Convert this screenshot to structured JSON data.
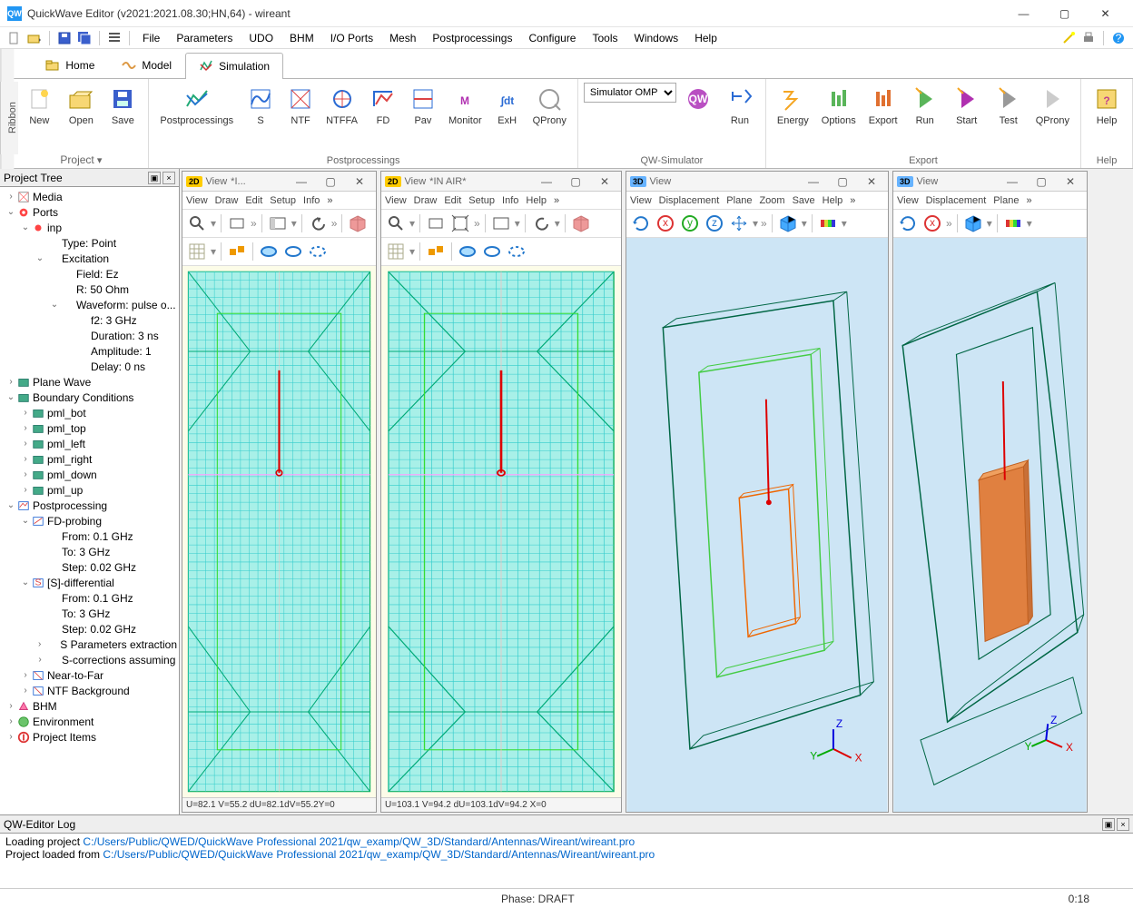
{
  "window": {
    "title": "QuickWave Editor (v2021:2021.08.30;HN,64) - wireant"
  },
  "menu": [
    "File",
    "Parameters",
    "UDO",
    "BHM",
    "I/O Ports",
    "Mesh",
    "Postprocessings",
    "Configure",
    "Tools",
    "Windows",
    "Help"
  ],
  "ribbon_tabs": [
    {
      "icon": "folder",
      "label": "Home"
    },
    {
      "icon": "wave",
      "label": "Model"
    },
    {
      "icon": "sim",
      "label": "Simulation",
      "active": true
    }
  ],
  "ribbon": {
    "project": {
      "label": "Project",
      "buttons": [
        {
          "label": "New",
          "icon": "new"
        },
        {
          "label": "Open",
          "icon": "open"
        },
        {
          "label": "Save",
          "icon": "save"
        }
      ]
    },
    "postproc": {
      "label": "Postprocessings",
      "header": "Postprocessings",
      "buttons": [
        {
          "label": "S",
          "icon": "s"
        },
        {
          "label": "NTF",
          "icon": "ntf"
        },
        {
          "label": "NTFFA",
          "icon": "ntffa"
        },
        {
          "label": "FD",
          "icon": "fd"
        },
        {
          "label": "Pav",
          "icon": "pav"
        },
        {
          "label": "Monitor",
          "icon": "mon"
        },
        {
          "label": "ExH",
          "icon": "exh"
        },
        {
          "label": "QProny",
          "icon": "qp"
        }
      ]
    },
    "simulator": {
      "label": "QW-Simulator",
      "select_value": "Simulator OMP",
      "run": "Run"
    },
    "export": {
      "label": "Export",
      "buttons": [
        {
          "label": "Energy",
          "icon": "en"
        },
        {
          "label": "Options",
          "icon": "opt"
        },
        {
          "label": "Export",
          "icon": "exp"
        },
        {
          "label": "Run",
          "icon": "run2"
        },
        {
          "label": "Start",
          "icon": "start"
        },
        {
          "label": "Test",
          "icon": "test"
        },
        {
          "label": "QProny",
          "icon": "qp2"
        }
      ]
    },
    "help": {
      "label": "Help"
    }
  },
  "project_tree": {
    "title": "Project Tree",
    "nodes": [
      {
        "d": 0,
        "tw": ">",
        "icon": "media",
        "label": "Media"
      },
      {
        "d": 0,
        "tw": "v",
        "icon": "ports",
        "label": "Ports"
      },
      {
        "d": 1,
        "tw": "v",
        "icon": "port",
        "label": "inp"
      },
      {
        "d": 2,
        "tw": "",
        "icon": "",
        "label": "Type: Point"
      },
      {
        "d": 2,
        "tw": "v",
        "icon": "",
        "label": "Excitation"
      },
      {
        "d": 3,
        "tw": "",
        "icon": "",
        "label": "Field: Ez"
      },
      {
        "d": 3,
        "tw": "",
        "icon": "",
        "label": "R: 50 Ohm"
      },
      {
        "d": 3,
        "tw": "v",
        "icon": "",
        "label": "Waveform: pulse o..."
      },
      {
        "d": 4,
        "tw": "",
        "icon": "",
        "label": "f2: 3 GHz"
      },
      {
        "d": 4,
        "tw": "",
        "icon": "",
        "label": "Duration: 3 ns"
      },
      {
        "d": 4,
        "tw": "",
        "icon": "",
        "label": "Amplitude: 1"
      },
      {
        "d": 4,
        "tw": "",
        "icon": "",
        "label": "Delay: 0 ns"
      },
      {
        "d": 0,
        "tw": ">",
        "icon": "pw",
        "label": "Plane Wave"
      },
      {
        "d": 0,
        "tw": "v",
        "icon": "bc",
        "label": "Boundary Conditions"
      },
      {
        "d": 1,
        "tw": ">",
        "icon": "pml",
        "label": "pml_bot"
      },
      {
        "d": 1,
        "tw": ">",
        "icon": "pml",
        "label": "pml_top"
      },
      {
        "d": 1,
        "tw": ">",
        "icon": "pml",
        "label": "pml_left"
      },
      {
        "d": 1,
        "tw": ">",
        "icon": "pml",
        "label": "pml_right"
      },
      {
        "d": 1,
        "tw": ">",
        "icon": "pml",
        "label": "pml_down"
      },
      {
        "d": 1,
        "tw": ">",
        "icon": "pml",
        "label": "pml_up"
      },
      {
        "d": 0,
        "tw": "v",
        "icon": "pp",
        "label": "Postprocessing"
      },
      {
        "d": 1,
        "tw": "v",
        "icon": "fd",
        "label": "FD-probing"
      },
      {
        "d": 2,
        "tw": "",
        "icon": "",
        "label": "From: 0.1 GHz"
      },
      {
        "d": 2,
        "tw": "",
        "icon": "",
        "label": "To: 3 GHz"
      },
      {
        "d": 2,
        "tw": "",
        "icon": "",
        "label": "Step: 0.02 GHz"
      },
      {
        "d": 1,
        "tw": "v",
        "icon": "sd",
        "label": "[S]-differential"
      },
      {
        "d": 2,
        "tw": "",
        "icon": "",
        "label": "From: 0.1 GHz"
      },
      {
        "d": 2,
        "tw": "",
        "icon": "",
        "label": "To: 3 GHz"
      },
      {
        "d": 2,
        "tw": "",
        "icon": "",
        "label": "Step: 0.02 GHz"
      },
      {
        "d": 2,
        "tw": ">",
        "icon": "",
        "label": "S Parameters extraction"
      },
      {
        "d": 2,
        "tw": ">",
        "icon": "",
        "label": "S-corrections assuming"
      },
      {
        "d": 1,
        "tw": ">",
        "icon": "ntf",
        "label": "Near-to-Far"
      },
      {
        "d": 1,
        "tw": ">",
        "icon": "ntf",
        "label": "NTF Background"
      },
      {
        "d": 0,
        "tw": ">",
        "icon": "bhm",
        "label": "BHM"
      },
      {
        "d": 0,
        "tw": ">",
        "icon": "env",
        "label": "Environment"
      },
      {
        "d": 0,
        "tw": ">",
        "icon": "proj",
        "label": "Project Items"
      }
    ]
  },
  "views": [
    {
      "type": "2D",
      "title": "View",
      "extra": "*I...",
      "menus": [
        "View",
        "Draw",
        "Edit",
        "Setup",
        "Info"
      ],
      "status": "U=82.1 V=55.2 dU=82.1dV=55.2Y=0"
    },
    {
      "type": "2D",
      "title": "View",
      "extra": "*IN AIR*",
      "menus": [
        "View",
        "Draw",
        "Edit",
        "Setup",
        "Info",
        "Help"
      ],
      "status": "U=103.1  V=94.2   dU=103.1dV=94.2  X=0"
    },
    {
      "type": "3D",
      "title": "View",
      "extra": "",
      "menus": [
        "View",
        "Displacement",
        "Plane",
        "Zoom",
        "Save",
        "Help"
      ],
      "status": ""
    },
    {
      "type": "3D",
      "title": "View",
      "extra": "",
      "menus": [
        "View",
        "Displacement",
        "Plane"
      ],
      "status": ""
    }
  ],
  "log": {
    "title": "QW-Editor Log",
    "line1_pre": "Loading project ",
    "line1_path": "C:/Users/Public/QWED/QuickWave Professional 2021/qw_examp/QW_3D/Standard/Antennas/Wireant/wireant.pro",
    "line2_pre": "Project loaded from ",
    "line2_path": "C:/Users/Public/QWED/QuickWave Professional 2021/qw_examp/QW_3D/Standard/Antennas/Wireant/wireant.pro"
  },
  "statusbar": {
    "phase": "Phase: DRAFT",
    "time": "0:18"
  }
}
